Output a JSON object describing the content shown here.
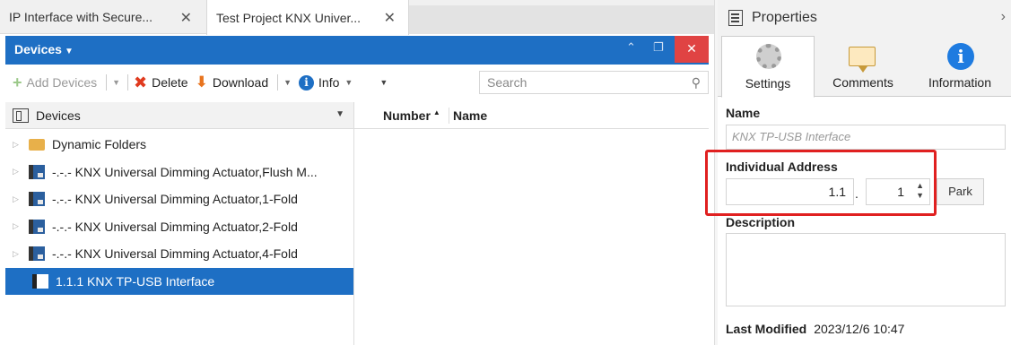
{
  "tabs": [
    {
      "label": "IP Interface with Secure...",
      "close": "✕"
    },
    {
      "label": "Test Project KNX Univer...",
      "close": "✕"
    }
  ],
  "devices_panel": {
    "title": "Devices",
    "window_buttons": {
      "up": "⌃",
      "restore": "❐",
      "close": "✕"
    }
  },
  "toolbar": {
    "add_devices": "Add Devices",
    "delete": "Delete",
    "download": "Download",
    "info": "Info",
    "search_placeholder": "Search"
  },
  "tree": {
    "header": "Devices",
    "items": [
      {
        "label": "Dynamic Folders",
        "type": "folder"
      },
      {
        "label": "-.-.- KNX Universal Dimming Actuator,Flush M...",
        "type": "device"
      },
      {
        "label": "-.-.- KNX Universal Dimming Actuator,1-Fold",
        "type": "device"
      },
      {
        "label": "-.-.- KNX Universal Dimming Actuator,2-Fold",
        "type": "device"
      },
      {
        "label": "-.-.- KNX Universal Dimming Actuator,4-Fold",
        "type": "device"
      },
      {
        "label": "1.1.1 KNX TP-USB Interface",
        "type": "device",
        "selected": true
      }
    ]
  },
  "grid": {
    "columns": [
      "Number",
      "Name"
    ]
  },
  "properties": {
    "title": "Properties",
    "tabs": [
      {
        "label": "Settings",
        "icon": "gear-icon",
        "active": true
      },
      {
        "label": "Comments",
        "icon": "comment-icon"
      },
      {
        "label": "Information",
        "icon": "info-icon"
      }
    ],
    "name_label": "Name",
    "name_placeholder": "KNX TP-USB Interface",
    "individual_address_label": "Individual Address",
    "address_part1": "1.1",
    "address_separator": ".",
    "address_part2": "1",
    "park_label": "Park",
    "description_label": "Description",
    "last_modified_label": "Last Modified",
    "last_modified_value": "2023/12/6 10:47"
  },
  "colors": {
    "accent": "#1e6fc4",
    "close_red": "#e04343",
    "highlight_box": "#e02020"
  }
}
